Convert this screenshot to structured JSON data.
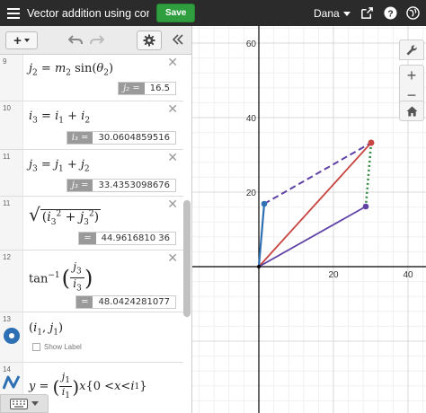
{
  "header": {
    "title": "Vector addition using comp...",
    "save_label": "Save",
    "user_name": "Dana"
  },
  "expressions": [
    {
      "number": "9",
      "result_label": "j₂ =",
      "result_value": "16.5"
    },
    {
      "number": "10",
      "result_label": "i₃ =",
      "result_value": "30.0604859516"
    },
    {
      "number": "11",
      "result_label": "j₃ =",
      "result_value": "33.4353098676"
    },
    {
      "number": "11",
      "result_label": "=",
      "result_value": "44.9616810 36"
    },
    {
      "number": "12",
      "result_label": "=",
      "result_value": "48.0424281077"
    },
    {
      "number": "13",
      "show_label": "Show Label"
    },
    {
      "number": "14"
    }
  ],
  "graph": {
    "x_ticks": [
      "20",
      "40"
    ],
    "y_ticks": [
      "60",
      "40",
      "20"
    ],
    "colors": {
      "red": "#c74440",
      "blue": "#2d70b3",
      "purple": "#6042a6",
      "green": "#388c46",
      "axis": "#000000",
      "grid": "#e6e6e6"
    }
  }
}
